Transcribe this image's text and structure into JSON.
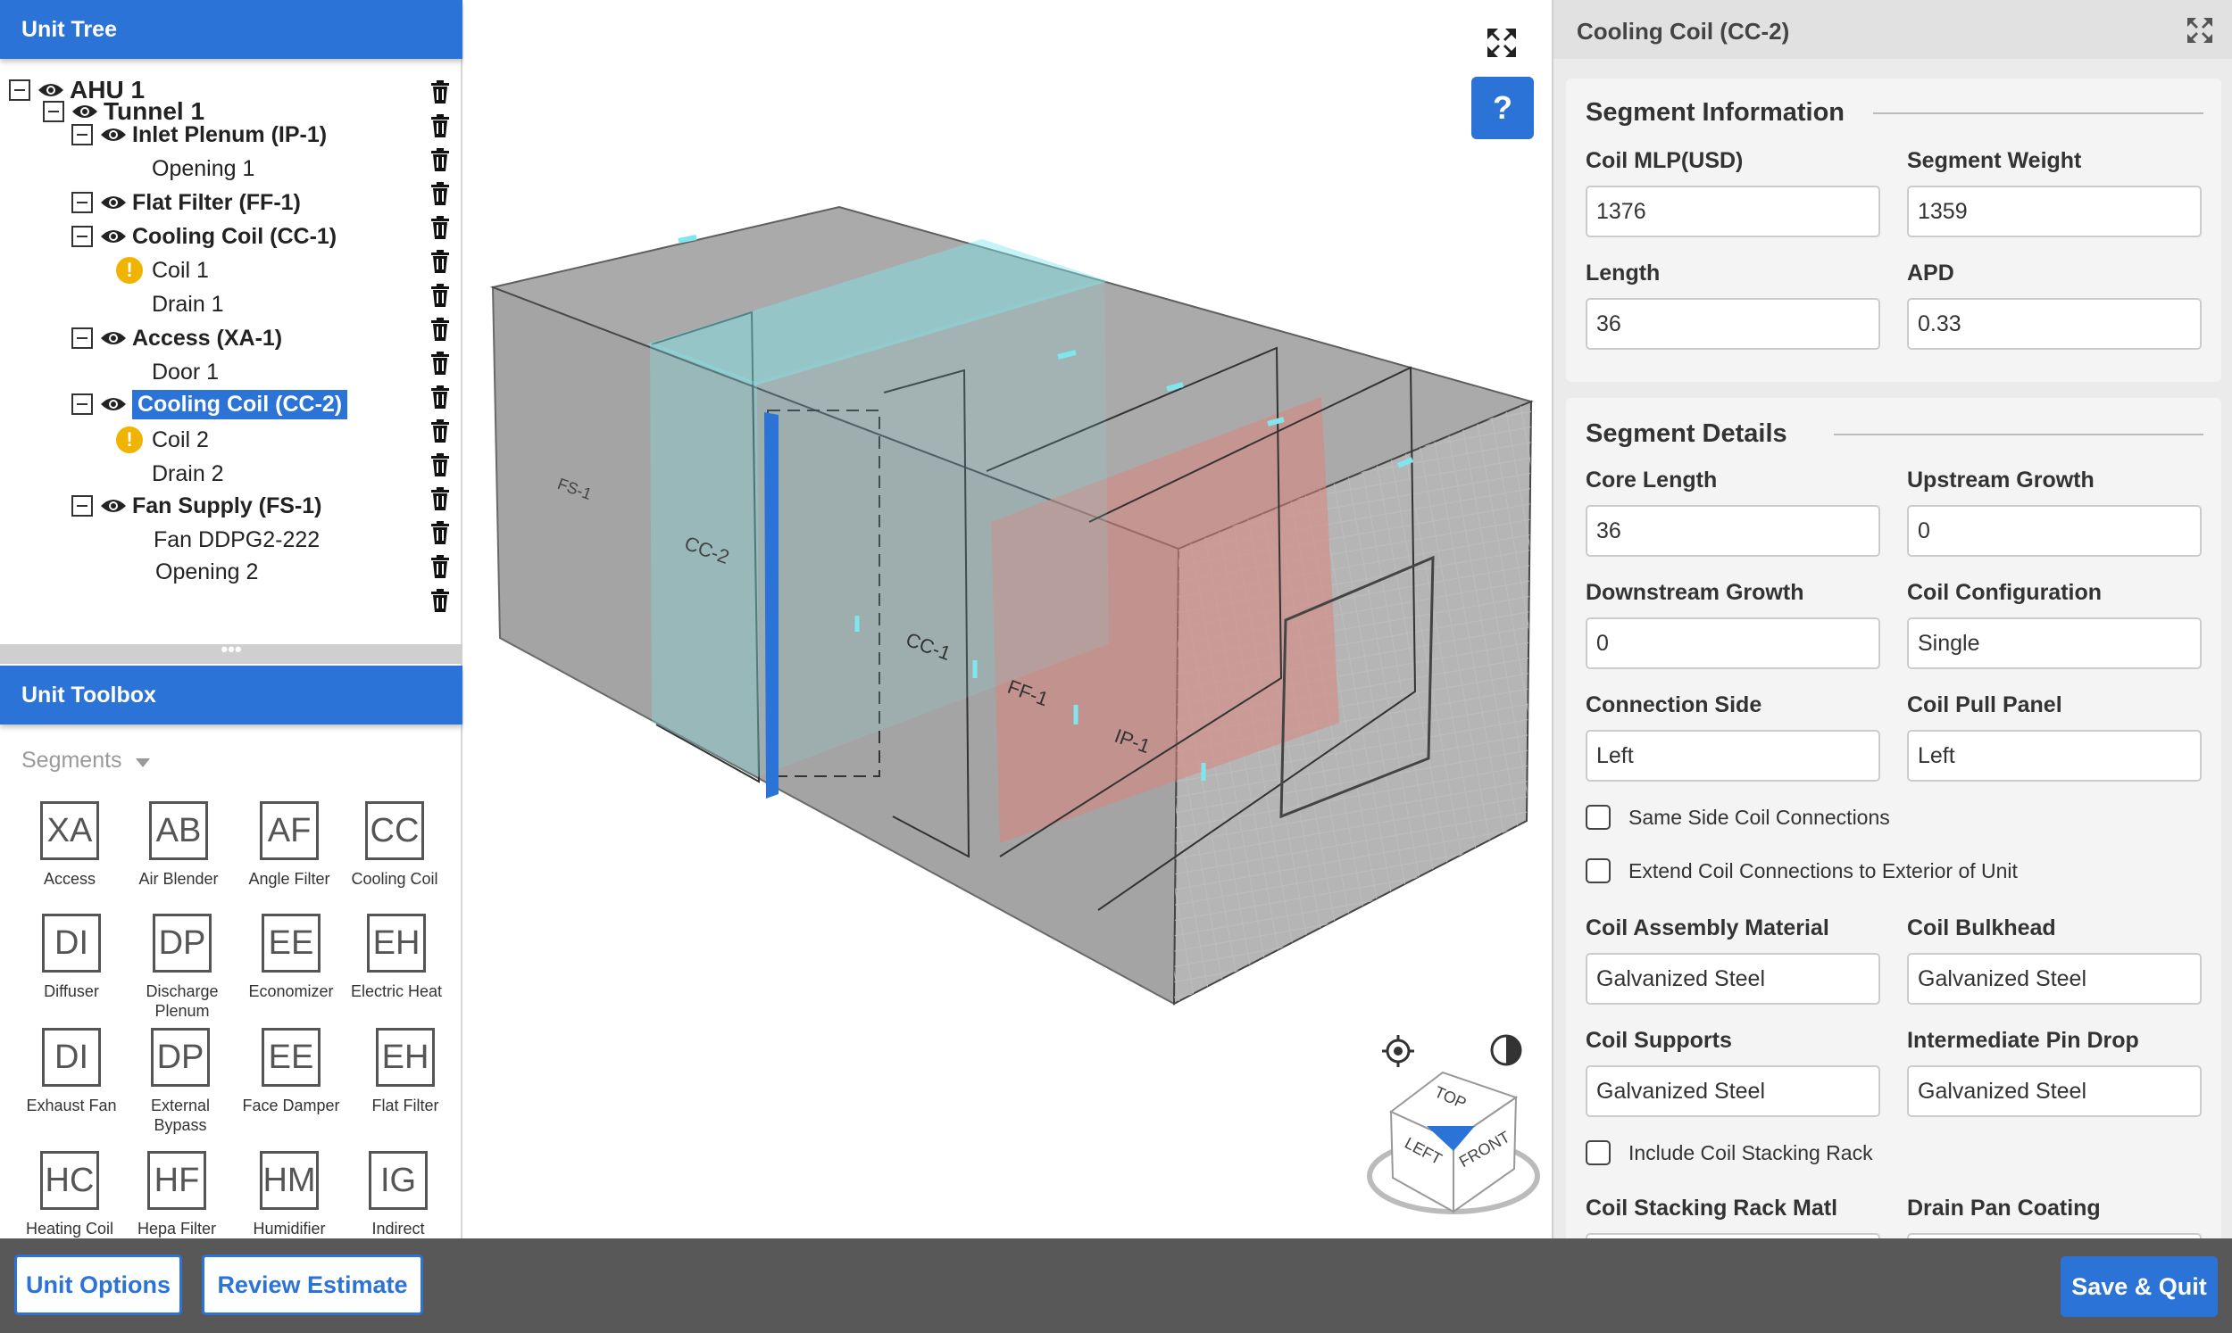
{
  "unit_tree": {
    "title": "Unit Tree",
    "nodes": [
      {
        "label": "AHU 1"
      },
      {
        "label": "Tunnel 1"
      },
      {
        "label": "Inlet Plenum (IP-1)"
      },
      {
        "label": "Opening 1"
      },
      {
        "label": "Flat Filter (FF-1)"
      },
      {
        "label": "Cooling Coil (CC-1)"
      },
      {
        "label": "Coil 1"
      },
      {
        "label": "Drain 1"
      },
      {
        "label": "Access (XA-1)"
      },
      {
        "label": "Door 1"
      },
      {
        "label": "Cooling Coil (CC-2)"
      },
      {
        "label": "Coil 2"
      },
      {
        "label": "Drain 2"
      },
      {
        "label": "Fan Supply (FS-1)"
      },
      {
        "label": "Fan DDPG2-222"
      },
      {
        "label": "Opening 2"
      }
    ],
    "warning_symbol": "!"
  },
  "toolbox": {
    "title": "Unit Toolbox",
    "divider": "•••",
    "category": "Segments",
    "items": [
      {
        "code": "XA",
        "label": "Access"
      },
      {
        "code": "AB",
        "label": "Air Blender"
      },
      {
        "code": "AF",
        "label": "Angle Filter"
      },
      {
        "code": "CC",
        "label": "Cooling Coil"
      },
      {
        "code": "DI",
        "label": "Diffuser"
      },
      {
        "code": "DP",
        "label": "Discharge Plenum"
      },
      {
        "code": "EE",
        "label": "Economizer"
      },
      {
        "code": "EH",
        "label": "Electric Heat"
      },
      {
        "code": "DI",
        "label": "Exhaust Fan"
      },
      {
        "code": "DP",
        "label": "External Bypass"
      },
      {
        "code": "EE",
        "label": "Face Damper"
      },
      {
        "code": "EH",
        "label": "Flat Filter"
      },
      {
        "code": "HC",
        "label": "Heating Coil"
      },
      {
        "code": "HF",
        "label": "Hepa Filter"
      },
      {
        "code": "HM",
        "label": "Humidifier"
      },
      {
        "code": "IG",
        "label": "Indirect"
      }
    ]
  },
  "viewport": {
    "help_label": "?",
    "segment_tags": [
      "FS-1",
      "CC-2",
      "CC-1",
      "FF-1",
      "IP-1"
    ],
    "cube_faces": {
      "top": "TOP",
      "left": "LEFT",
      "front": "FRONT"
    },
    "icons": [
      "expand-icon",
      "target-icon",
      "contrast-icon",
      "view-cube-icon"
    ]
  },
  "properties": {
    "title": "Cooling Coil (CC-2)",
    "segment_information": {
      "heading": "Segment Information",
      "coil_mlp_label": "Coil MLP(USD)",
      "coil_mlp_value": "1376",
      "segment_weight_label": "Segment Weight",
      "segment_weight_value": "1359",
      "length_label": "Length",
      "length_value": "36",
      "apd_label": "APD",
      "apd_value": "0.33"
    },
    "segment_details": {
      "heading": "Segment Details",
      "core_length_label": "Core Length",
      "core_length_value": "36",
      "upstream_growth_label": "Upstream Growth",
      "upstream_growth_value": "0",
      "downstream_growth_label": "Downstream Growth",
      "downstream_growth_value": "0",
      "coil_configuration_label": "Coil Configuration",
      "coil_configuration_value": "Single",
      "connection_side_label": "Connection Side",
      "connection_side_value": "Left",
      "coil_pull_panel_label": "Coil Pull Panel",
      "coil_pull_panel_value": "Left",
      "same_side_label": "Same Side Coil Connections",
      "extend_label": "Extend Coil Connections to Exterior of Unit",
      "assembly_material_label": "Coil Assembly Material",
      "assembly_material_value": "Galvanized Steel",
      "bulkhead_label": "Coil Bulkhead",
      "bulkhead_value": "Galvanized Steel",
      "supports_label": "Coil Supports",
      "supports_value": "Galvanized Steel",
      "pin_drop_label": "Intermediate Pin Drop",
      "pin_drop_value": "Galvanized Steel",
      "stacking_rack_label": "Include Coil Stacking Rack",
      "stacking_rack_matl_label": "Coil Stacking Rack Matl",
      "drain_pan_coating_label": "Drain Pan Coating"
    }
  },
  "footer": {
    "unit_options": "Unit Options",
    "review_estimate": "Review Estimate",
    "save_quit": "Save & Quit"
  },
  "colors": {
    "accent": "#2b73d6",
    "warning": "#f0b400",
    "highlight": "#7fe6ee",
    "selection_box": "#d9837c"
  }
}
